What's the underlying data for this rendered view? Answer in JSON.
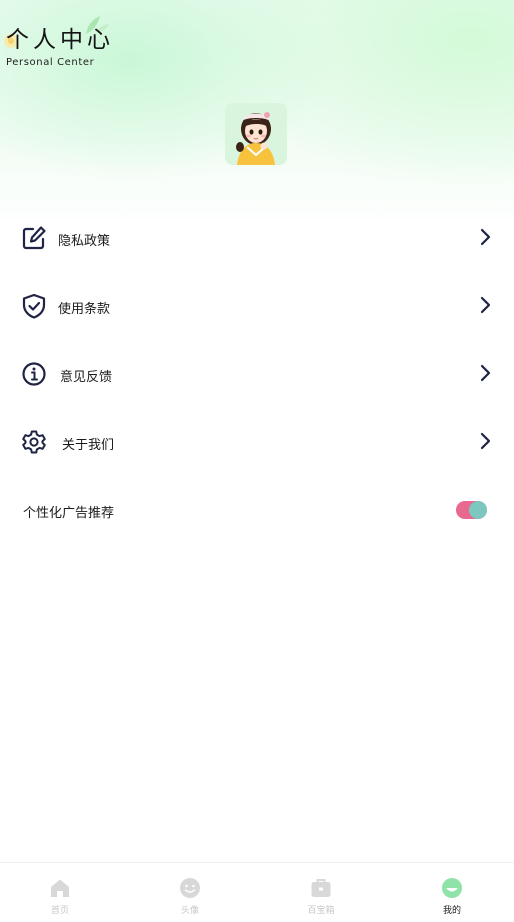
{
  "header": {
    "title_cn": "个人中心",
    "title_en": "Personal Center"
  },
  "profile": {
    "avatar_icon": "avatar-girl-illustration"
  },
  "menu": [
    {
      "label": "隐私政策",
      "icon": "edit-icon"
    },
    {
      "label": "使用条款",
      "icon": "shield-check-icon"
    },
    {
      "label": "意见反馈",
      "icon": "info-icon"
    },
    {
      "label": "关于我们",
      "icon": "gear-icon"
    }
  ],
  "settings": {
    "ad_label": "个性化广告推荐",
    "ad_enabled": true
  },
  "tabbar": {
    "items": [
      {
        "label": "首页",
        "icon": "home-icon",
        "active": false
      },
      {
        "label": "头像",
        "icon": "smile-icon",
        "active": false
      },
      {
        "label": "百宝箱",
        "icon": "toolbox-icon",
        "active": false
      },
      {
        "label": "我的",
        "icon": "mine-icon",
        "active": true
      }
    ]
  },
  "colors": {
    "accent_green": "#8fe3a8",
    "toggle_pink": "#e8688f",
    "toggle_knob": "#7cc8be",
    "icon_navy": "#1f2446"
  }
}
